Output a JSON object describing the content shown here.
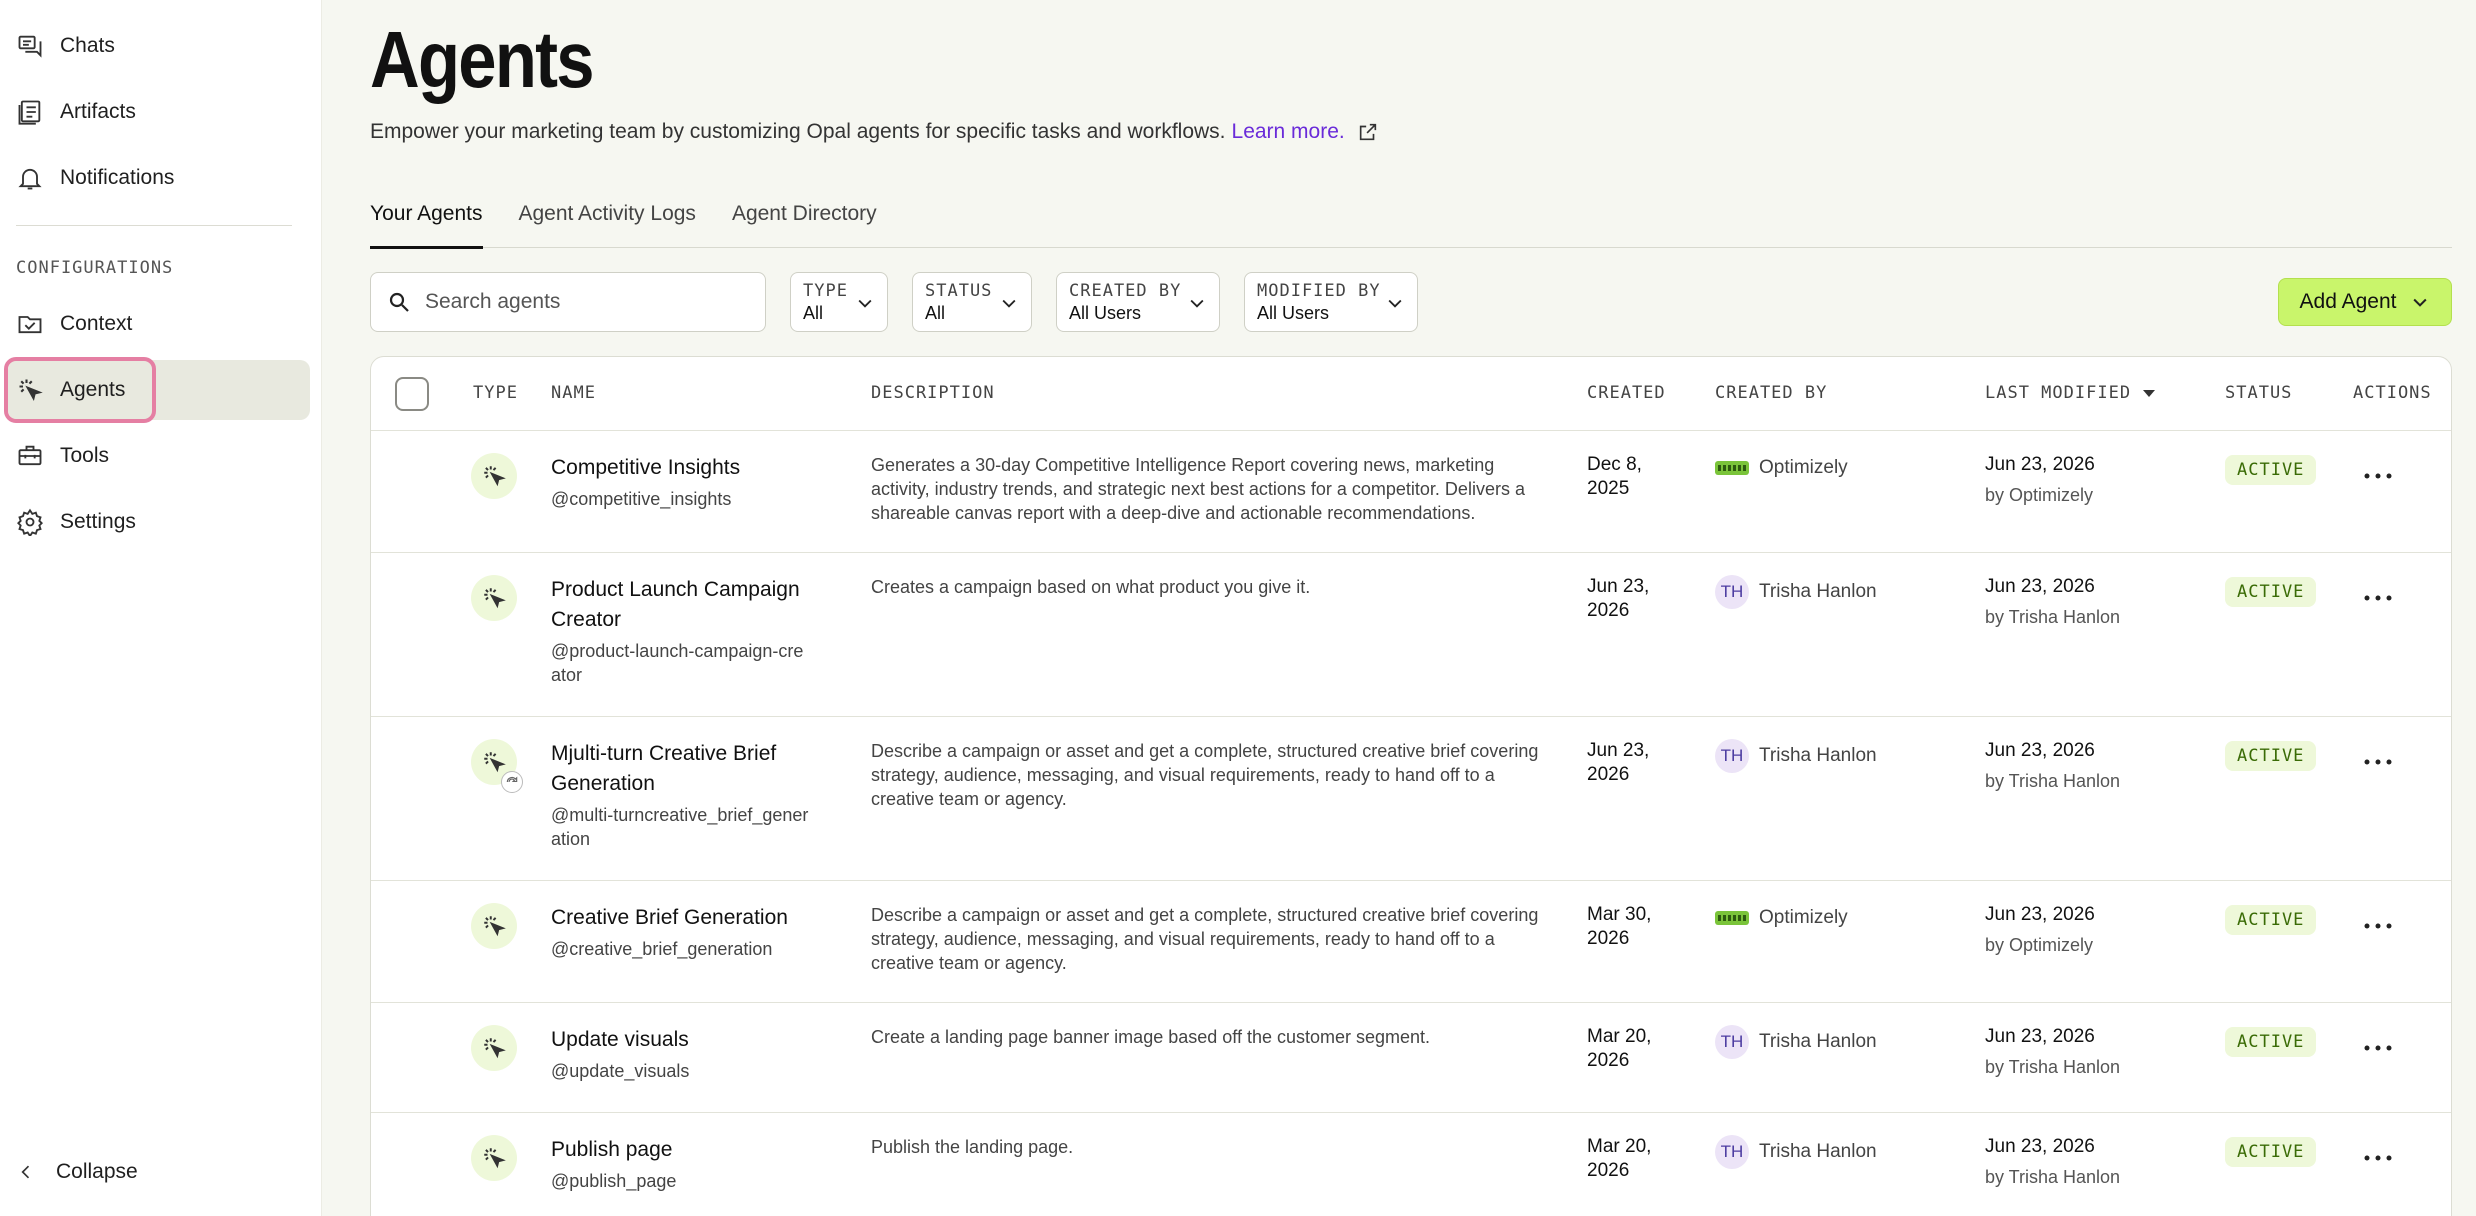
{
  "sidebar": {
    "items": [
      {
        "label": "Chats",
        "icon": "chat-icon"
      },
      {
        "label": "Artifacts",
        "icon": "artifact-icon"
      },
      {
        "label": "Notifications",
        "icon": "bell-icon"
      }
    ],
    "section_label": "CONFIGURATIONS",
    "config_items": [
      {
        "label": "Context",
        "icon": "context-icon"
      },
      {
        "label": "Agents",
        "icon": "agent-icon",
        "active": true
      },
      {
        "label": "Tools",
        "icon": "toolbox-icon"
      },
      {
        "label": "Settings",
        "icon": "gear-icon"
      }
    ],
    "collapse_label": "Collapse"
  },
  "header": {
    "title": "Agents",
    "subtitle": "Empower your marketing team by customizing Opal agents for specific tasks and workflows.",
    "learn_more": "Learn more."
  },
  "tabs": [
    {
      "label": "Your Agents",
      "active": true
    },
    {
      "label": "Agent Activity Logs"
    },
    {
      "label": "Agent Directory"
    }
  ],
  "toolbar": {
    "search_placeholder": "Search agents",
    "filters": [
      {
        "label": "TYPE",
        "value": "All"
      },
      {
        "label": "STATUS",
        "value": "All"
      },
      {
        "label": "CREATED BY",
        "value": "All Users"
      },
      {
        "label": "MODIFIED BY",
        "value": "All Users"
      }
    ],
    "add_label": "Add Agent"
  },
  "table": {
    "columns": [
      "TYPE",
      "NAME",
      "DESCRIPTION",
      "CREATED",
      "CREATED BY",
      "LAST MODIFIED",
      "STATUS",
      "ACTIONS"
    ],
    "rows": [
      {
        "name": "Competitive Insights",
        "handle": "@competitive_insights",
        "description": "Generates a 30-day Competitive Intelligence Report covering news, marketing activity, industry trends, and strategic next best actions for a competitor. Delivers a shareable canvas report with a deep-dive and actionable recommendations.",
        "created": "Dec 8, 2025",
        "created_by": "Optimizely",
        "created_by_type": "logo",
        "modified": "Jun 23, 2026",
        "modified_by": "by Optimizely",
        "status": "ACTIVE"
      },
      {
        "name": "Product Launch Campaign Creator",
        "handle": "@product-launch-campaign-creator",
        "description": "Creates a campaign based on what product you give it.",
        "created": "Jun 23, 2026",
        "created_by": "Trisha Hanlon",
        "initials": "TH",
        "modified": "Jun 23, 2026",
        "modified_by": "by Trisha Hanlon",
        "status": "ACTIVE"
      },
      {
        "name": "Mjulti-turn Creative Brief Generation",
        "handle": "@multi-turncreative_brief_generation",
        "description": "Describe a campaign or asset and get a complete, structured creative brief covering strategy, audience, messaging, and visual requirements, ready to hand off to a creative team or agency.",
        "created": "Jun 23, 2026",
        "created_by": "Trisha Hanlon",
        "initials": "TH",
        "modified": "Jun 23, 2026",
        "modified_by": "by Trisha Hanlon",
        "status": "ACTIVE",
        "multi_turn": true
      },
      {
        "name": "Creative Brief Generation",
        "handle": "@creative_brief_generation",
        "description": "Describe a campaign or asset and get a complete, structured creative brief covering strategy, audience, messaging, and visual requirements, ready to hand off to a creative team or agency.",
        "created": "Mar 30, 2026",
        "created_by": "Optimizely",
        "created_by_type": "logo",
        "modified": "Jun 23, 2026",
        "modified_by": "by Optimizely",
        "status": "ACTIVE"
      },
      {
        "name": "Update visuals",
        "handle": "@update_visuals",
        "description": "Create a landing page banner image based off the customer segment.",
        "created": "Mar 20, 2026",
        "created_by": "Trisha Hanlon",
        "initials": "TH",
        "modified": "Jun 23, 2026",
        "modified_by": "by Trisha Hanlon",
        "status": "ACTIVE"
      },
      {
        "name": "Publish page",
        "handle": "@publish_page",
        "description": "Publish the landing page.",
        "created": "Mar 20, 2026",
        "created_by": "Trisha Hanlon",
        "initials": "TH",
        "modified": "Jun 23, 2026",
        "modified_by": "by Trisha Hanlon",
        "status": "ACTIVE"
      }
    ]
  },
  "colors": {
    "accent": "#c9f56b",
    "link": "#6a2bd9",
    "status_bg": "#eef8d9",
    "status_text": "#3a6b06",
    "focus_ring": "#e57fa3"
  }
}
